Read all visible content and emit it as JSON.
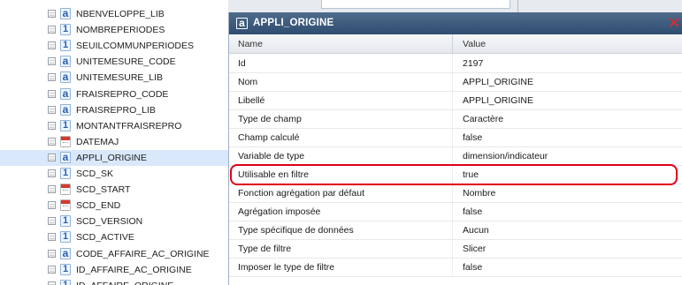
{
  "tree": {
    "items": [
      {
        "type": "a",
        "label": "NBENVELOPPE_LIB"
      },
      {
        "type": "1",
        "label": "NOMBREPERIODES"
      },
      {
        "type": "1",
        "label": "SEUILCOMMUNPERIODES"
      },
      {
        "type": "a",
        "label": "UNITEMESURE_CODE"
      },
      {
        "type": "a",
        "label": "UNITEMESURE_LIB"
      },
      {
        "type": "a",
        "label": "FRAISREPRO_CODE"
      },
      {
        "type": "a",
        "label": "FRAISREPRO_LIB"
      },
      {
        "type": "1",
        "label": "MONTANTFRAISREPRO"
      },
      {
        "type": "date",
        "label": "DATEMAJ"
      },
      {
        "type": "a",
        "label": "APPLI_ORIGINE",
        "selected": true
      },
      {
        "type": "1",
        "label": "SCD_SK"
      },
      {
        "type": "date",
        "label": "SCD_START"
      },
      {
        "type": "date",
        "label": "SCD_END"
      },
      {
        "type": "1",
        "label": "SCD_VERSION"
      },
      {
        "type": "1",
        "label": "SCD_ACTIVE"
      },
      {
        "type": "a",
        "label": "CODE_AFFAIRE_AC_ORIGINE"
      },
      {
        "type": "1",
        "label": "ID_AFFAIRE_AC_ORIGINE"
      },
      {
        "type": "1",
        "label": "ID_AFFAIRE_ORIGINE"
      }
    ]
  },
  "panel": {
    "icon_letter": "a",
    "title": "APPLI_ORIGINE",
    "close_symbol": "✕",
    "columns": {
      "name": "Name",
      "value": "Value"
    },
    "rows": [
      {
        "name": "Id",
        "value": "2197"
      },
      {
        "name": "Nom",
        "value": "APPLI_ORIGINE"
      },
      {
        "name": "Libellé",
        "value": "APPLI_ORIGINE"
      },
      {
        "name": "Type de champ",
        "value": "Caractère"
      },
      {
        "name": "Champ calculé",
        "value": "false"
      },
      {
        "name": "Variable de type",
        "value": "dimension/indicateur",
        "highlighted": true
      },
      {
        "name": "Utilisable en filtre",
        "value": "true"
      },
      {
        "name": "Fonction agrégation par défaut",
        "value": "Nombre"
      },
      {
        "name": "Agrégation imposée",
        "value": "false"
      },
      {
        "name": "Type spécifique de données",
        "value": "Aucun"
      },
      {
        "name": "Type de filtre",
        "value": "Slicer"
      },
      {
        "name": "Imposer le type de filtre",
        "value": "false"
      }
    ]
  },
  "colors": {
    "header": "#3d5b7e",
    "highlight_border": "#e0001a",
    "selected_row": "#d9e8fb",
    "close": "#e12a2a"
  }
}
